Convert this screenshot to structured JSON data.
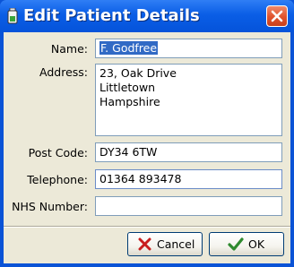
{
  "window": {
    "title": "Edit Patient Details"
  },
  "icons": {
    "app": "battery-icon",
    "close": "close-x-icon",
    "cancel": "red-x-icon",
    "ok": "checkmark-icon"
  },
  "form": {
    "name_label": "Name:",
    "name_value": "F. Godfree",
    "address_label": "Address:",
    "address_lines": [
      "23, Oak Drive",
      "Littletown",
      "Hampshire"
    ],
    "postcode_label": "Post Code:",
    "postcode_value": "DY34 6TW",
    "telephone_label": "Telephone:",
    "telephone_value": "01364 893478",
    "nhs_label": "NHS Number:",
    "nhs_value": ""
  },
  "buttons": {
    "cancel_label": "Cancel",
    "ok_label": "OK"
  },
  "colors": {
    "title_bar": "#0a5ee6",
    "selection": "#316ac5",
    "dialog_background": "#ece9d8",
    "close_button": "#e0522c"
  }
}
